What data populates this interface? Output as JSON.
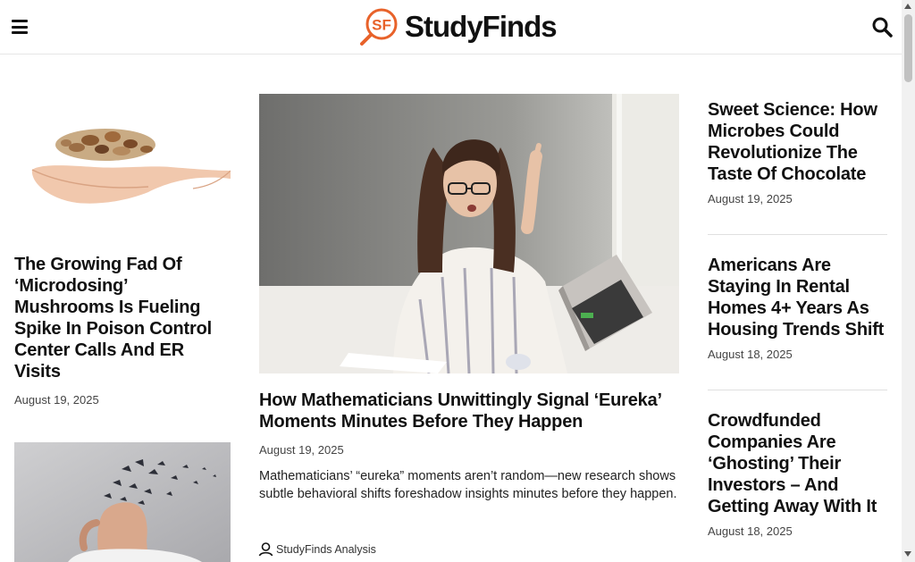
{
  "header": {
    "logo_mark": "SF",
    "logo_text": "StudyFinds",
    "menu_icon": "hamburger-menu-icon",
    "search_icon": "search-icon"
  },
  "left_column": {
    "articles": [
      {
        "image": "hand-holding-dried-mushrooms-photo",
        "title": "The Growing Fad Of ‘Microdosing’ Mushrooms Is Fueling Spike In Poison Control Center Calls And ER Visits",
        "date": "August 19, 2025"
      },
      {
        "image": "man-with-dissolving-head-photo"
      }
    ]
  },
  "featured": {
    "image": "woman-at-laptop-eureka-photo",
    "title": "How Mathematicians Unwittingly Signal ‘Eureka’ Moments Minutes Before They Happen",
    "date": "August 19, 2025",
    "excerpt": "Mathematicians’ “eureka” moments aren’t random—new research shows subtle behavioral shifts foreshadow insights minutes before they happen.",
    "author": "StudyFinds Analysis",
    "author_icon": "user-icon"
  },
  "right_column": {
    "articles": [
      {
        "title": "Sweet Science: How Microbes Could Revolutionize The Taste Of Chocolate",
        "date": "August 19, 2025"
      },
      {
        "title": "Americans Are Staying In Rental Homes 4+ Years As Housing Trends Shift",
        "date": "August 18, 2025"
      },
      {
        "title": "Crowdfunded Companies Are ‘Ghosting’ Their Investors – And Getting Away With It",
        "date": "August 18, 2025"
      }
    ]
  },
  "colors": {
    "brand_orange": "#e8622a",
    "text": "#111111",
    "meta": "#444444"
  }
}
